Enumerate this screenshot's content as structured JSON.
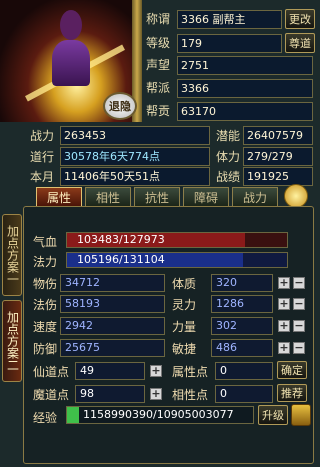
{
  "profile": {
    "title_label": "称谓",
    "title_value": "3366 副帮主",
    "change_button": "更改",
    "level_label": "等级",
    "level_value": "179",
    "respect_button": "尊道",
    "fame_label": "声望",
    "fame_value": "2751",
    "faction_label": "帮派",
    "faction_value": "3366",
    "contribution_label": "帮贡",
    "contribution_value": "63170",
    "retreat_button": "退隐"
  },
  "info": {
    "power_label": "战力",
    "power_value": "263453",
    "potential_label": "潜能",
    "potential_value": "26407579",
    "dao_label": "道行",
    "dao_value": "30578年6天774点",
    "stamina_label": "体力",
    "stamina_value": "279/279",
    "season_label": "本月",
    "season_value": "11406年50天51点",
    "merit_label": "战绩",
    "merit_value": "191925"
  },
  "tabs": [
    "属性",
    "相性",
    "抗性",
    "障碍",
    "战力"
  ],
  "side_tabs": [
    "加点方案一",
    "加点方案二"
  ],
  "bars": {
    "hp_label": "气血",
    "hp_text": "103483/127973",
    "hp_fraction": 0.809,
    "mp_label": "法力",
    "mp_text": "105196/131104",
    "mp_fraction": 0.802,
    "hp_color": "#8b1a1a",
    "mp_color": "#1a2f8b"
  },
  "stats": {
    "phys_label": "物伤",
    "phys_value": "34712",
    "con_label": "体质",
    "con_value": "320",
    "mag_label": "法伤",
    "mag_value": "58193",
    "spi_label": "灵力",
    "spi_value": "1286",
    "spd_label": "速度",
    "spd_value": "2942",
    "str_label": "力量",
    "str_value": "302",
    "def_label": "防御",
    "def_value": "25675",
    "agi_label": "敏捷",
    "agi_value": "486",
    "immortal_label": "仙道点",
    "immortal_value": "49",
    "attr_label": "属性点",
    "attr_value": "0",
    "demon_label": "魔道点",
    "demon_value": "98",
    "phase_label": "相性点",
    "phase_value": "0",
    "confirm_button": "确定",
    "recommend_button": "推荐"
  },
  "experience": {
    "label": "经验",
    "value": "1158990390/10905003077",
    "upgrade_button": "升级"
  }
}
